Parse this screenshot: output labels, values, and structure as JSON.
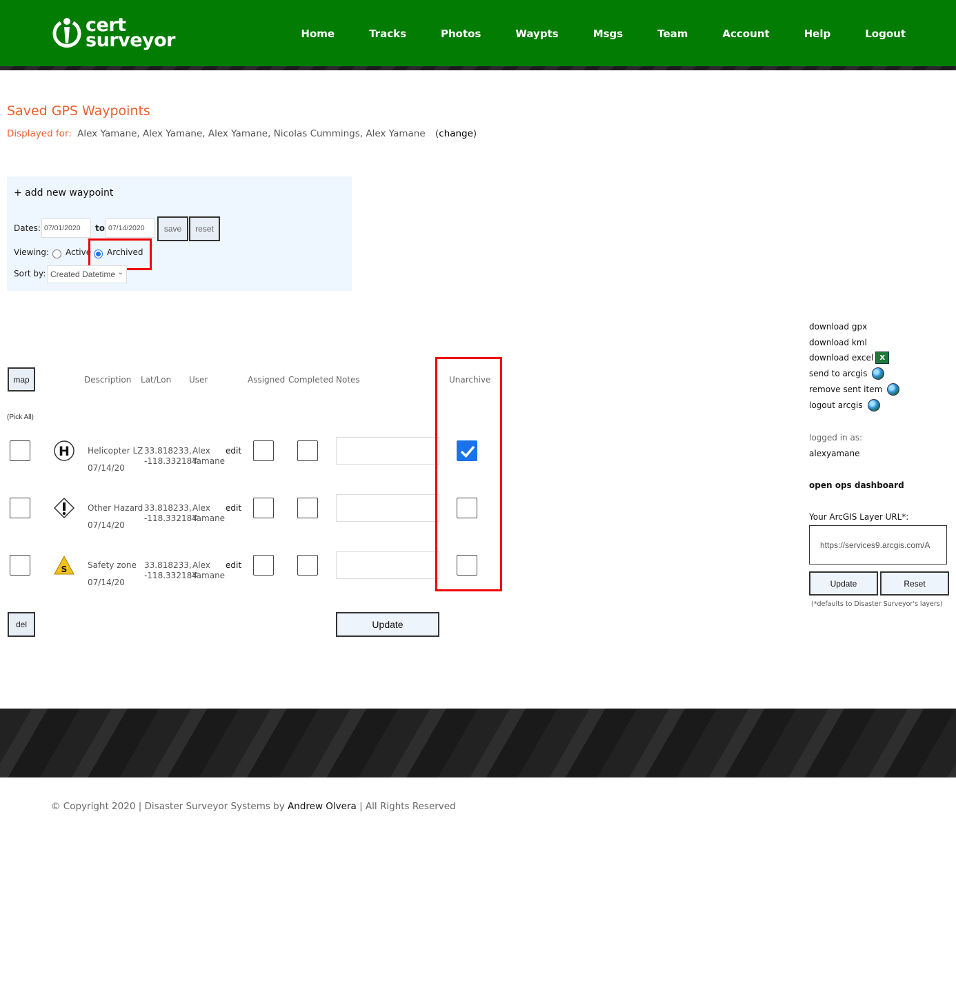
{
  "brand": {
    "name_line1": "cert",
    "name_line2": "surveyor",
    "header_color": "#037c03",
    "accent_color": "#e8622f"
  },
  "nav": [
    "Home",
    "Tracks",
    "Photos",
    "Waypts",
    "Msgs",
    "Team",
    "Account",
    "Help",
    "Logout"
  ],
  "page": {
    "title": "Saved GPS Waypoints",
    "displayed_label": "Displayed for:",
    "displayed_users": "Alex Yamane, Alex Yamane, Alex Yamane, Nicolas Cummings, Alex Yamane",
    "change_open": "(",
    "change_link": "change",
    "change_close": ")"
  },
  "filters": {
    "add_new": "+ add new waypoint",
    "dates_label": "Dates:",
    "date_from": "07/01/2020",
    "to_label": "to",
    "date_to": "07/14/2020",
    "save_label": "save",
    "reset_label": "reset",
    "viewing_label": "Viewing:",
    "active_label": "Active",
    "archived_label": "Archived",
    "viewing_selected": "Archived",
    "sort_label": "Sort by:",
    "sort_value": "Created Datetime"
  },
  "table": {
    "map_label": "map",
    "pick_all": "(Pick All)",
    "headers": {
      "description": "Description",
      "latlon": "Lat/Lon",
      "user": "User",
      "assigned": "Assigned",
      "completed": "Completed",
      "notes": "Notes",
      "unarchive": "Unarchive"
    },
    "rows": [
      {
        "icon": "helicopter-icon",
        "description": "Helicopter LZ",
        "date": "07/14/20",
        "lat": "33.818233,",
        "lon": "-118.332184",
        "user_first": "Alex",
        "user_last": "Yamane",
        "edit": "edit",
        "unarchive_checked": true
      },
      {
        "icon": "hazard-icon",
        "description": "Other Hazard",
        "date": "07/14/20",
        "lat": "33.818233,",
        "lon": "-118.332184",
        "user_first": "Alex",
        "user_last": "Yamane",
        "edit": "edit",
        "unarchive_checked": false
      },
      {
        "icon": "safety-zone-icon",
        "description": "Safety zone",
        "date": "07/14/20",
        "lat": "33.818233,",
        "lon": "-118.332184",
        "user_first": "Alex",
        "user_last": "Yamane",
        "edit": "edit",
        "unarchive_checked": false
      }
    ],
    "del_label": "del",
    "update_label": "Update"
  },
  "sidebar": {
    "links": [
      "download gpx",
      "download kml",
      "download excel",
      "send to arcgis",
      "remove sent item",
      "logout arcgis"
    ],
    "logged_in_label": "logged in as:",
    "username": "alexyamane",
    "ops_dashboard": "open ops dashboard",
    "arcgis_label": "Your ArcGIS Layer URL*:",
    "arcgis_url": "https://services9.arcgis.com/A",
    "update_label": "Update",
    "reset_label": "Reset",
    "note": "(*defaults to Disaster Surveyor's layers)"
  },
  "footer": {
    "copyright_prefix": "© Copyright 2020 | Disaster Surveyor Systems by",
    "author": "Andrew Olvera",
    "copyright_suffix": "| All Rights Reserved"
  }
}
